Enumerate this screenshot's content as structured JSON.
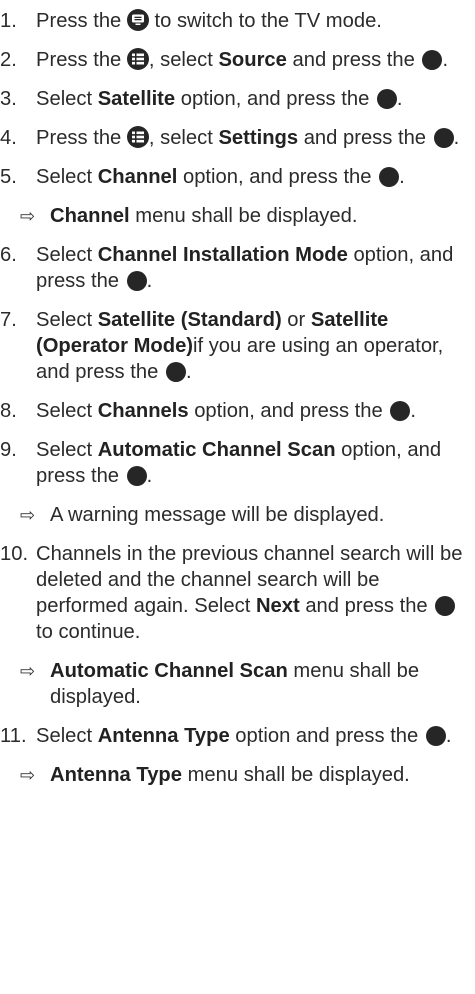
{
  "steps": [
    {
      "n": "1.",
      "t1": "Press the ",
      "icon": "tv-mode-button-icon",
      "t2": " to switch to the TV mode."
    },
    {
      "n": "2.",
      "t1": "Press the ",
      "icon": "menu-button-icon",
      "t2": ", select ",
      "b1": "Source",
      "t3": " and press the ",
      "t4": "."
    },
    {
      "n": "3.",
      "t1": "Select ",
      "b1": "Satellite",
      "t2": " option, and press the ",
      "t3": "."
    },
    {
      "n": "4.",
      "t1": "Press the ",
      "icon": "menu-button-icon",
      "t2": ", select ",
      "b1": "Settings",
      "t3": " and press the ",
      "t4": "."
    },
    {
      "n": "5.",
      "t1": "Select ",
      "b1": "Channel",
      "t2": " option, and press the ",
      "t3": "."
    },
    {
      "n": "6.",
      "t1": "Select ",
      "b1": "Channel Installation Mode",
      "t2": " option, and press the ",
      "t3": "."
    },
    {
      "n": "7.",
      "t1": "Select ",
      "b1": "Satellite (Standard)",
      "t2": " or ",
      "b2": "Satellite (Operator Mode)",
      "t3": "if you are using an operator, and press the ",
      "t4": "."
    },
    {
      "n": "8.",
      "t1": "Select ",
      "b1": "Channels",
      "t2": " option, and press the ",
      "t3": "."
    },
    {
      "n": "9.",
      "t1": "Select ",
      "b1": "Automatic Channel Scan",
      "t2": " option, and press the ",
      "t3": "."
    },
    {
      "n": "10.",
      "t1": "Channels in the previous channel search will be deleted and the channel search will be performed again. Select ",
      "b1": "Next",
      "t2": " and press the ",
      "t3": " to continue."
    },
    {
      "n": "11.",
      "t1": "Select ",
      "b1": "Antenna Type",
      "t2": " option and press the ",
      "t3": "."
    }
  ],
  "results": {
    "r5": {
      "arrow": "⇨",
      "b1": "Channel",
      "t1": " menu shall be displayed."
    },
    "r9": {
      "arrow": "⇨",
      "t1": "A warning message will be displayed."
    },
    "r10": {
      "arrow": "⇨",
      "b1": "Automatic Channel Scan",
      "t1": " menu shall be displayed."
    },
    "r11": {
      "arrow": "⇨",
      "b1": "Antenna Type",
      "t1": " menu shall be displayed."
    }
  },
  "ok_button_icon": "ok-button-icon",
  "colors": {
    "text": "#2b2b2b",
    "icon": "#262626"
  }
}
